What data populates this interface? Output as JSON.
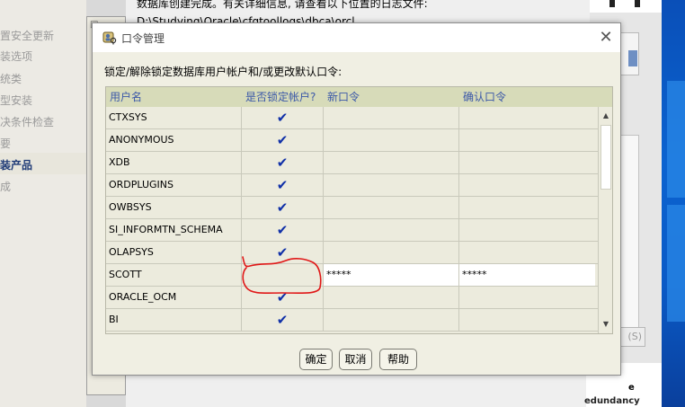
{
  "background": {
    "top_text": {
      "line1": "数据库创建完成。有关详细信息, 请查看以下位置的日志文件:",
      "line2": "D:\\Studying\\Oracle\\cfgtoollogs\\dbca\\orcl。"
    },
    "steps": [
      {
        "label": "置安全更新"
      },
      {
        "label": "装选项"
      },
      {
        "label": "统类"
      },
      {
        "label": "型安装"
      },
      {
        "label": "决条件检查"
      },
      {
        "label": "要"
      },
      {
        "label": "装产品"
      },
      {
        "label": "成"
      }
    ],
    "active_step_index": 6,
    "right_logo_text_fragment": "e",
    "right_bottom_text": "edundancy",
    "right_button_label": "(S)"
  },
  "dialog": {
    "title": "口令管理",
    "close_label": "✕",
    "instruction": "锁定/解除锁定数据库用户帐户和/或更改默认口令:",
    "columns": {
      "user": "用户名",
      "locked": "是否锁定帐户?",
      "new_password": "新口令",
      "confirm_password": "确认口令"
    },
    "check_mark": "✔",
    "rows": [
      {
        "user": "CTXSYS",
        "locked": true,
        "new_password": "",
        "confirm_password": ""
      },
      {
        "user": "ANONYMOUS",
        "locked": true,
        "new_password": "",
        "confirm_password": ""
      },
      {
        "user": "XDB",
        "locked": true,
        "new_password": "",
        "confirm_password": ""
      },
      {
        "user": "ORDPLUGINS",
        "locked": true,
        "new_password": "",
        "confirm_password": ""
      },
      {
        "user": "OWBSYS",
        "locked": true,
        "new_password": "",
        "confirm_password": ""
      },
      {
        "user": "SI_INFORMTN_SCHEMA",
        "locked": true,
        "new_password": "",
        "confirm_password": ""
      },
      {
        "user": "OLAPSYS",
        "locked": true,
        "new_password": "",
        "confirm_password": ""
      },
      {
        "user": "SCOTT",
        "locked": false,
        "new_password": "*****",
        "confirm_password": "*****"
      },
      {
        "user": "ORACLE_OCM",
        "locked": true,
        "new_password": "",
        "confirm_password": ""
      },
      {
        "user": "BI",
        "locked": true,
        "new_password": "",
        "confirm_password": ""
      }
    ],
    "buttons": {
      "ok": "确定",
      "cancel": "取消",
      "help": "帮助"
    }
  },
  "colors": {
    "header_bg": "#d7dbb9",
    "header_text": "#3b58a8",
    "check_color": "#1030a8",
    "annotation_red": "#e01818"
  }
}
